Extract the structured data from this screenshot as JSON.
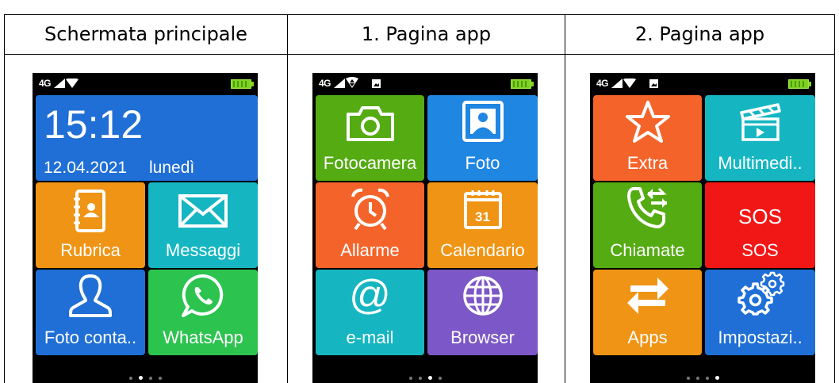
{
  "columns": [
    {
      "header": "Schermata principale",
      "clock": {
        "time": "15:12",
        "date": "12.04.2021",
        "day": "lunedì"
      },
      "tiles": [
        {
          "label": "Rubrica",
          "icon": "contacts-book-icon",
          "color": "#ef9414"
        },
        {
          "label": "Messaggi",
          "icon": "envelope-icon",
          "color": "#15b6c2"
        },
        {
          "label": "Foto conta..",
          "icon": "person-outline-icon",
          "color": "#1f6fd6"
        },
        {
          "label": "WhatsApp",
          "icon": "whatsapp-icon",
          "color": "#2cc34f"
        }
      ],
      "page_indicator": {
        "count": 4,
        "active": 1
      }
    },
    {
      "header": "1. Pagina app",
      "tiles": [
        {
          "label": "Fotocamera",
          "icon": "camera-icon",
          "color": "#54ab12"
        },
        {
          "label": "Foto",
          "icon": "photo-icon",
          "color": "#1f86e2"
        },
        {
          "label": "Allarme",
          "icon": "alarm-clock-icon",
          "color": "#f4642a"
        },
        {
          "label": "Calendario",
          "icon": "calendar-icon",
          "color": "#ef9414",
          "calendar_day": "31"
        },
        {
          "label": "e-mail",
          "icon": "at-sign-icon",
          "color": "#15b6c2"
        },
        {
          "label": "Browser",
          "icon": "globe-icon",
          "color": "#7c57c7"
        }
      ],
      "page_indicator": {
        "count": 4,
        "active": 2
      }
    },
    {
      "header": "2. Pagina app",
      "tiles": [
        {
          "label": "Extra",
          "icon": "star-icon",
          "color": "#f4642a"
        },
        {
          "label": "Multimedi..",
          "icon": "clapperboard-icon",
          "color": "#15b6c2"
        },
        {
          "label": "Chiamate",
          "icon": "phone-arrows-icon",
          "color": "#54ab12"
        },
        {
          "label": "SOS",
          "icon": "sos-icon",
          "color": "#f21717",
          "icon_text": "SOS"
        },
        {
          "label": "Apps",
          "icon": "swap-arrows-icon",
          "color": "#ef9414"
        },
        {
          "label": "Impostazi..",
          "icon": "gears-icon",
          "color": "#1f6fd6"
        }
      ],
      "page_indicator": {
        "count": 4,
        "active": 3
      }
    }
  ],
  "status_bar": {
    "network": "4G"
  }
}
